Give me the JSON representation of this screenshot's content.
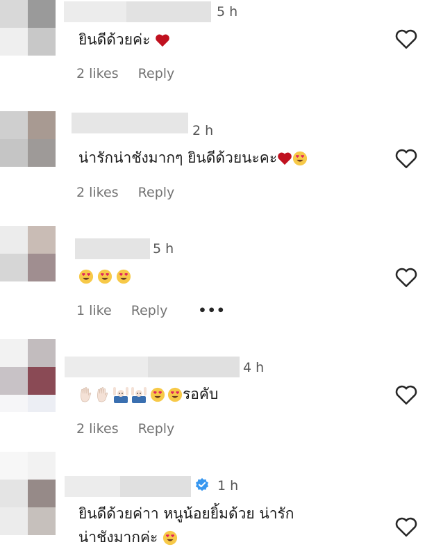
{
  "colors": {
    "text": "#1a1a1a",
    "meta": "#737373",
    "heart_red": "#c0111f",
    "emoji_yellow": "#f7c948",
    "verified_blue": "#3797f0"
  },
  "comments": [
    {
      "time": "5 h",
      "text": "ยินดีด้วยค่ะ",
      "likes": "2 likes",
      "reply": "Reply",
      "trailing_emoji": [
        "red-heart"
      ]
    },
    {
      "time": "2 h",
      "text": "น่ารักน่าชังมากๆ ยินดีด้วยนะคะ",
      "likes": "2 likes",
      "reply": "Reply",
      "trailing_emoji": [
        "red-heart",
        "heart-eyes"
      ]
    },
    {
      "time": "5 h",
      "text": "",
      "likes": "1 like",
      "reply": "Reply",
      "more": "•••",
      "leading_emoji": [
        "heart-eyes",
        "heart-eyes",
        "heart-eyes"
      ]
    },
    {
      "time": "4 h",
      "text": "รอคับ",
      "likes": "2 likes",
      "reply": "Reply",
      "leading_emoji": [
        "raised-hand",
        "raised-hand",
        "person-raising-hands",
        "person-raising-hands",
        "heart-eyes",
        "heart-eyes"
      ]
    },
    {
      "time": "1 h",
      "verified": true,
      "text_line1": "ยินดีด้วยค่าา หนูน้อยยิ้มด้วย น่ารัก",
      "text_line2": "น่าชังมากค่ะ",
      "trailing_emoji": [
        "heart-eyes"
      ]
    }
  ],
  "icons": {
    "like_button": "heart-outline-icon",
    "verified_badge": "verified-badge-icon",
    "more_options": "ellipsis-icon"
  }
}
